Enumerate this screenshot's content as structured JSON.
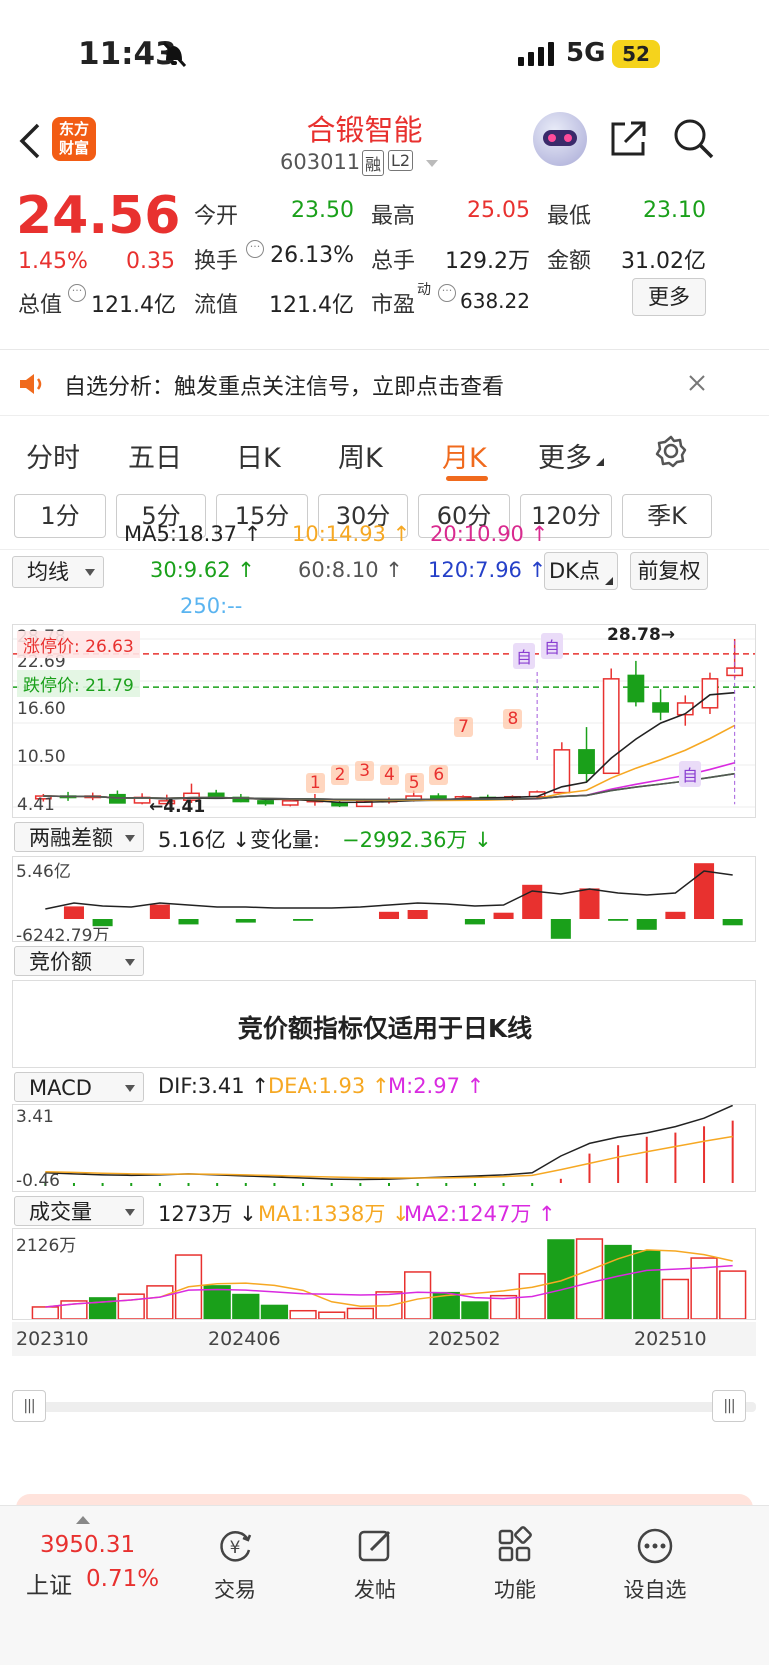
{
  "status_bar": {
    "time": "11:43",
    "network": "5G",
    "battery": "52"
  },
  "nav": {
    "logo_line1": "东方",
    "logo_line2": "财富",
    "stock_name": "合锻智能",
    "stock_code": "603011",
    "tag_margin": "融",
    "tag_level": "L2"
  },
  "quote": {
    "price": "24.56",
    "change_pct": "1.45%",
    "change_amt": "0.35",
    "open_label": "今开",
    "open": "23.50",
    "high_label": "最高",
    "high": "25.05",
    "low_label": "最低",
    "low": "23.10",
    "turnover_label": "换手",
    "turnover": "26.13%",
    "volume_label": "总手",
    "volume": "129.2万",
    "amount_label": "金额",
    "amount": "31.02亿",
    "mktcap_label": "总值",
    "mktcap": "121.4亿",
    "float_label": "流值",
    "float_cap": "121.4亿",
    "pe_label": "市盈",
    "pe_sup": "动",
    "pe": "638.22",
    "more_button": "更多"
  },
  "notice": {
    "text": "自选分析：触发重点关注信号，立即点击查看"
  },
  "tabs": {
    "items": [
      "分时",
      "五日",
      "日K",
      "周K",
      "月K",
      "更多"
    ],
    "active": "月K"
  },
  "periods": [
    "1分",
    "5分",
    "15分",
    "30分",
    "60分",
    "120分",
    "季K"
  ],
  "ma": {
    "select": "均线",
    "ma5": "MA5:18.37 ↑",
    "ma10": "10:14.93 ↑",
    "ma20": "20:10.90 ↑",
    "ma30": "30:9.62 ↑",
    "ma60": "60:8.10 ↑",
    "ma120": "120:7.96 ↑",
    "ma250": "250:--",
    "dk_button": "DK点",
    "fq_button": "前复权"
  },
  "kline": {
    "limit_up_label": "涨停价: 26.63",
    "limit_down_label": "跌停价: 21.79",
    "y_labels": [
      "28.78",
      "22.69",
      "16.60",
      "10.50",
      "4.41"
    ],
    "max_label": "28.78→",
    "min_label": "←4.41",
    "markers": [
      "1",
      "2",
      "3",
      "4",
      "5",
      "6",
      "7",
      "8"
    ],
    "self_marks": [
      "自",
      "自",
      "自"
    ],
    "candles": [
      {
        "o": 5.6,
        "h": 6.3,
        "l": 5.2,
        "c": 6.0
      },
      {
        "o": 6.0,
        "h": 6.6,
        "l": 5.3,
        "c": 5.9
      },
      {
        "o": 5.9,
        "h": 6.5,
        "l": 5.4,
        "c": 6.0
      },
      {
        "o": 6.2,
        "h": 6.8,
        "l": 5.6,
        "c": 5.0
      },
      {
        "o": 5.0,
        "h": 6.4,
        "l": 4.8,
        "c": 5.8
      },
      {
        "o": 4.9,
        "h": 6.2,
        "l": 4.6,
        "c": 5.3
      },
      {
        "o": 5.4,
        "h": 7.8,
        "l": 5.0,
        "c": 6.4
      },
      {
        "o": 6.4,
        "h": 6.9,
        "l": 5.6,
        "c": 5.8
      },
      {
        "o": 5.8,
        "h": 6.3,
        "l": 5.1,
        "c": 5.2
      },
      {
        "o": 5.3,
        "h": 5.6,
        "l": 4.6,
        "c": 4.9
      },
      {
        "o": 4.7,
        "h": 5.5,
        "l": 4.5,
        "c": 5.3
      },
      {
        "o": 5.2,
        "h": 6.3,
        "l": 4.6,
        "c": 5.4
      },
      {
        "o": 5.0,
        "h": 5.5,
        "l": 4.4,
        "c": 4.6
      },
      {
        "o": 4.5,
        "h": 5.6,
        "l": 4.41,
        "c": 5.3
      },
      {
        "o": 5.3,
        "h": 5.8,
        "l": 4.9,
        "c": 5.4
      },
      {
        "o": 5.5,
        "h": 6.8,
        "l": 5.2,
        "c": 6.0
      },
      {
        "o": 6.0,
        "h": 6.4,
        "l": 5.5,
        "c": 5.7
      },
      {
        "o": 5.6,
        "h": 6.1,
        "l": 5.3,
        "c": 5.9
      },
      {
        "o": 5.8,
        "h": 6.2,
        "l": 5.4,
        "c": 5.6
      },
      {
        "o": 5.6,
        "h": 6.1,
        "l": 5.3,
        "c": 5.9
      },
      {
        "o": 5.9,
        "h": 6.8,
        "l": 5.6,
        "c": 6.6
      },
      {
        "o": 6.5,
        "h": 13.8,
        "l": 6.3,
        "c": 12.7
      },
      {
        "o": 12.7,
        "h": 16.0,
        "l": 8.0,
        "c": 9.3
      },
      {
        "o": 9.3,
        "h": 24.5,
        "l": 9.2,
        "c": 23.0
      },
      {
        "o": 23.5,
        "h": 25.6,
        "l": 19.0,
        "c": 19.7
      },
      {
        "o": 19.5,
        "h": 21.5,
        "l": 17.0,
        "c": 18.2
      },
      {
        "o": 17.8,
        "h": 20.6,
        "l": 16.2,
        "c": 19.5
      },
      {
        "o": 18.8,
        "h": 23.9,
        "l": 17.9,
        "c": 23.0
      },
      {
        "o": 23.5,
        "h": 28.78,
        "l": 23.1,
        "c": 24.56
      }
    ]
  },
  "margin": {
    "select": "两融差额",
    "value": "5.16亿 ↓",
    "change_label": "变化量:",
    "change": "−2992.36万 ↓",
    "y_top": "5.46亿",
    "y_bottom": "-6242.79万"
  },
  "auction": {
    "select": "竞价额",
    "message": "竞价额指标仅适用于日K线"
  },
  "macd": {
    "select": "MACD",
    "dif": "DIF:3.41 ↑",
    "dea": "DEA:1.93 ↑",
    "m": "M:2.97 ↑",
    "y_top": "3.41",
    "y_bottom": "-0.46"
  },
  "volume_ind": {
    "select": "成交量",
    "value": "1273万 ↓",
    "ma1": "MA1:1338万 ↓",
    "ma2": "MA2:1247万 ↑",
    "y_top": "2126万"
  },
  "x_axis": [
    "202310",
    "202406",
    "202502",
    "202510"
  ],
  "chart_data": {
    "type": "candlestick",
    "title": "合锻智能 603011 月K",
    "x_labels": [
      "202310",
      "202406",
      "202502",
      "202510"
    ],
    "ohlc_ref": "kline.candles",
    "volume": [
      320,
      480,
      560,
      660,
      880,
      1700,
      880,
      650,
      360,
      220,
      180,
      280,
      720,
      1250,
      700,
      450,
      620,
      1200,
      2100,
      2126,
      1950,
      1810,
      1050,
      1620,
      1273
    ],
    "macd_hist": [
      0,
      0,
      0,
      0,
      0,
      0,
      0,
      0,
      0,
      0,
      0,
      0,
      0,
      0,
      0,
      0,
      0,
      0,
      0.2,
      1.4,
      1.8,
      2.2,
      2.4,
      2.7,
      2.97
    ]
  },
  "bottom_nav": {
    "index_value": "3950.31",
    "index_name": "上证",
    "index_pct": "0.71%",
    "items": [
      "交易",
      "发帖",
      "功能",
      "设自选"
    ]
  }
}
